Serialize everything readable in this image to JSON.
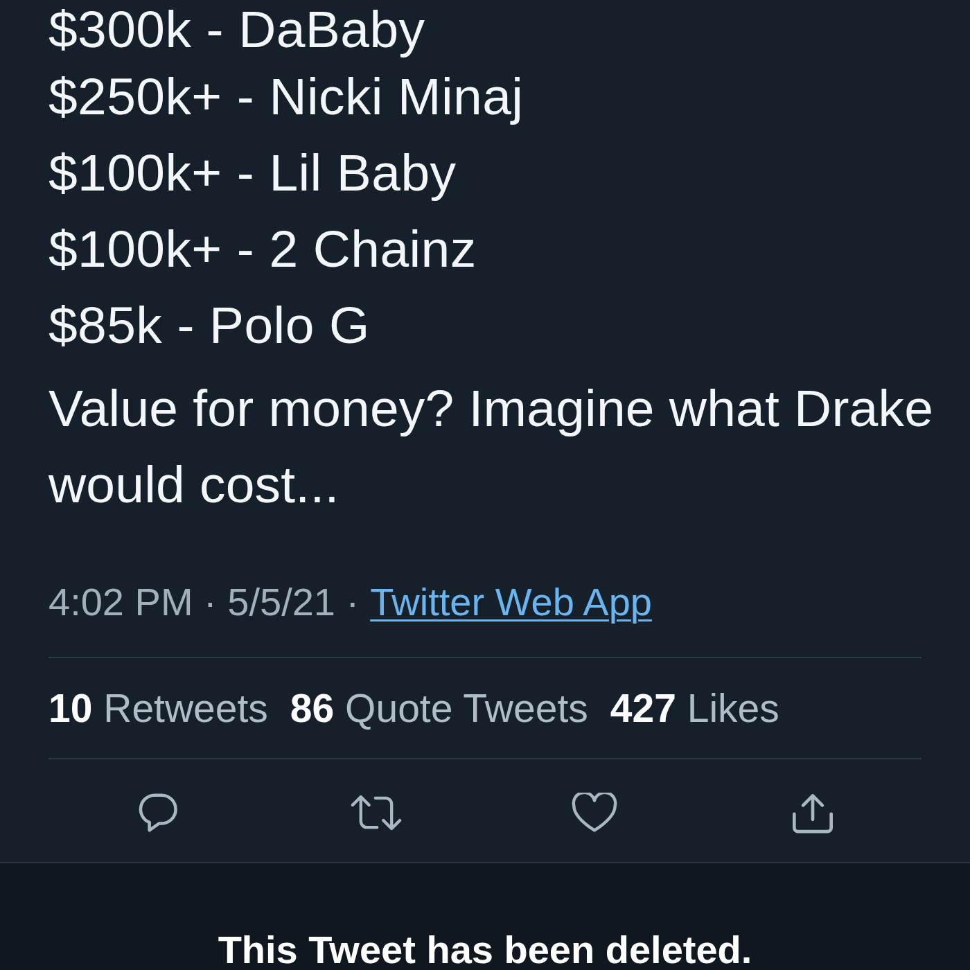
{
  "tweet": {
    "lines": [
      "$300k - DaBaby",
      "$250k+ - Nicki Minaj",
      "$100k+ - Lil Baby",
      "$100k+ - 2 Chainz",
      "$85k - Polo G"
    ],
    "paragraph": "Value for money? Imagine what Drake would cost...",
    "meta": {
      "timestamp": "4:02 PM · 5/5/21 ·",
      "source": "Twitter Web App"
    },
    "stats": [
      {
        "count": "10",
        "label": "Retweets"
      },
      {
        "count": "86",
        "label": "Quote Tweets"
      },
      {
        "count": "427",
        "label": "Likes"
      }
    ],
    "actions": [
      {
        "kind": "reply"
      },
      {
        "kind": "retweet"
      },
      {
        "kind": "like"
      },
      {
        "kind": "share"
      }
    ]
  },
  "notice": "This Tweet has been deleted."
}
